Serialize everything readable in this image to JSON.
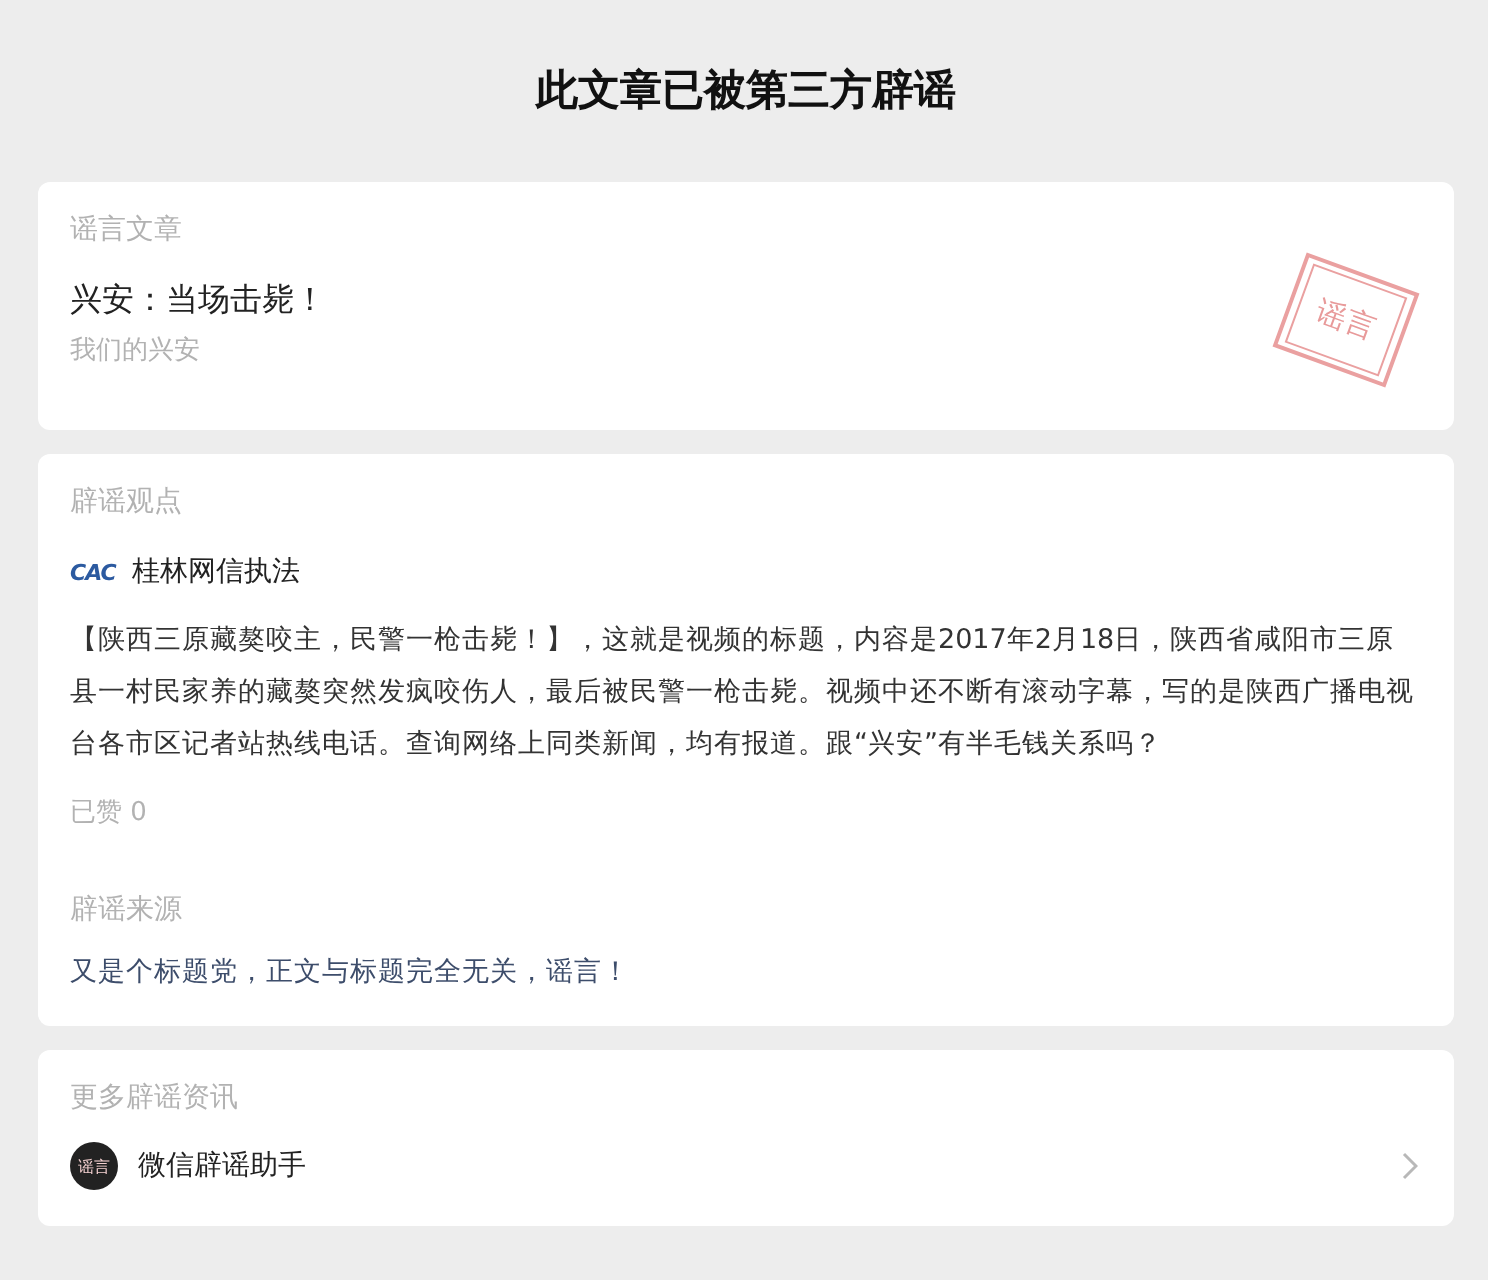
{
  "page_title": "此文章已被第三方辟谣",
  "rumor_article": {
    "heading": "谣言文章",
    "title": "兴安：当场击毙！",
    "source": "我们的兴安",
    "stamp": "谣言"
  },
  "debunk": {
    "heading": "辟谣观点",
    "org_logo": "CAC",
    "org_name": "桂林网信执法",
    "body": "【陕西三原藏獒咬主，民警一枪击毙！】，这就是视频的标题，内容是2017年2月18日，陕西省咸阳市三原县一村民家养的藏獒突然发疯咬伤人，最后被民警一枪击毙。视频中还不断有滚动字幕，写的是陕西广播电视台各市区记者站热线电话。查询网络上同类新闻，均有报道。跟“兴安”有半毛钱关系吗？",
    "likes": "已赞 0",
    "source_heading": "辟谣来源",
    "source_text": "又是个标题党，正文与标题完全无关，谣言！"
  },
  "more": {
    "heading": "更多辟谣资讯",
    "avatar_text": "谣言",
    "name": "微信辟谣助手"
  }
}
